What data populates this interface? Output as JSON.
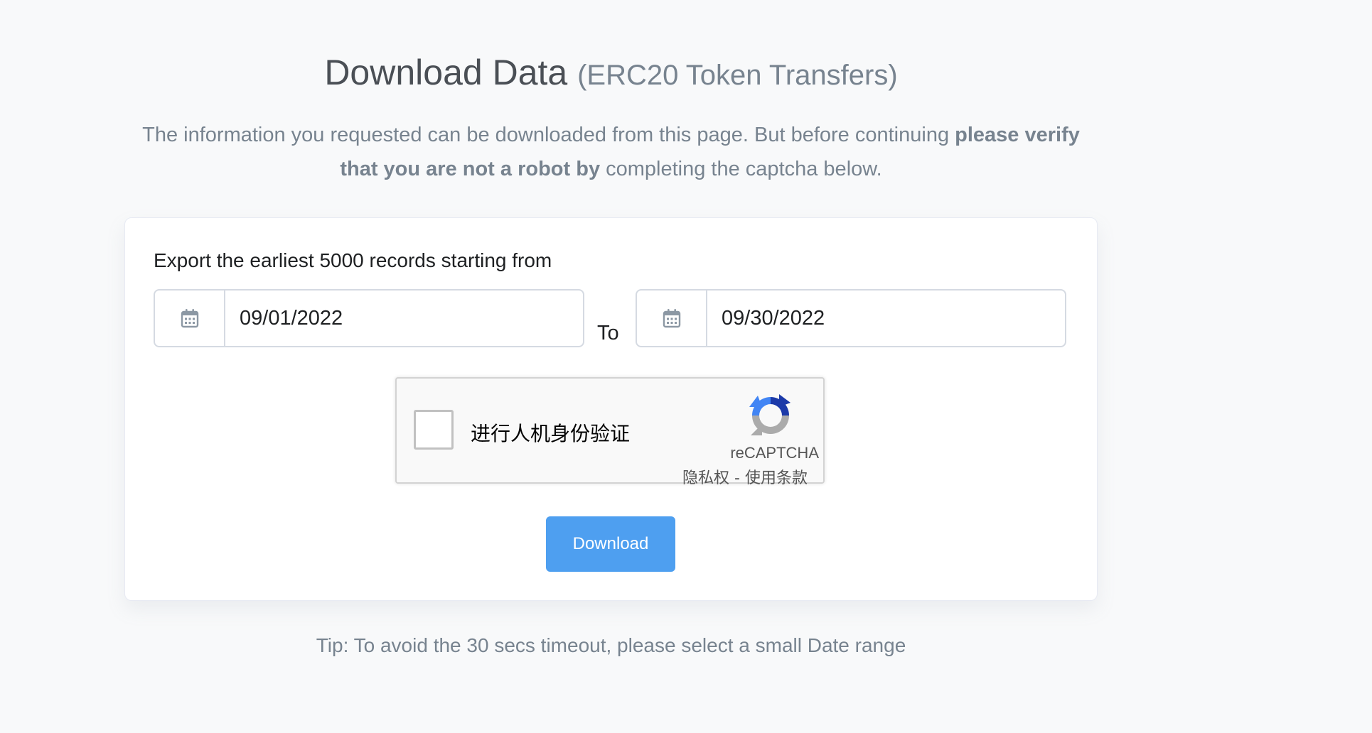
{
  "header": {
    "title": "Download Data",
    "subtitle": "(ERC20 Token Transfers)",
    "intro_text_1": "The information you requested can be downloaded from this page. But before continuing ",
    "intro_bold": "please verify that you are not a robot by",
    "intro_text_2": " completing the captcha below."
  },
  "form": {
    "label": "Export the earliest 5000 records starting from",
    "from_date": "09/01/2022",
    "to_label": "To",
    "to_date": "09/30/2022",
    "calendar_icon": "calendar-icon"
  },
  "captcha": {
    "checkbox_label": "进行人机身份验证",
    "brand": "reCAPTCHA",
    "privacy_link": "隐私权",
    "separator": " - ",
    "terms_link": "使用条款",
    "logo_icon": "recaptcha-logo-icon"
  },
  "actions": {
    "download_label": "Download"
  },
  "tip": {
    "text": "Tip: To avoid the 30 secs timeout, please select a small Date range"
  },
  "colors": {
    "background": "#f8f9fa",
    "button": "#4e9ff0",
    "muted_text": "#77838f"
  }
}
